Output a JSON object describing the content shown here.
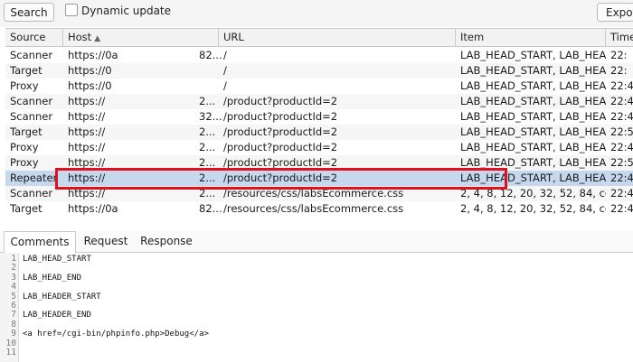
{
  "toolbar": {
    "search_label": "Search",
    "dynamic_update_label": "Dynamic update",
    "dynamic_update_checked": false,
    "export_label": "Expor"
  },
  "table": {
    "columns": [
      "Source",
      "Host",
      "URL",
      "Item",
      "Time"
    ],
    "sorted_column": "Host",
    "rows": [
      {
        "source": "Scanner",
        "host_a": "https://0a",
        "host_b": "82...",
        "url": "/",
        "item": "LAB_HEAD_START, LAB_HEA...",
        "time": "22:"
      },
      {
        "source": "Target",
        "host_a": "https://0",
        "host_b": "",
        "url": "/",
        "item": "LAB_HEAD_START, LAB_HEA...",
        "time": "22:"
      },
      {
        "source": "Proxy",
        "host_a": "https://0",
        "host_b": "",
        "url": "/",
        "item": "LAB_HEAD_START, LAB_HEA...",
        "time": "22:4"
      },
      {
        "source": "Scanner",
        "host_a": "https://",
        "host_b": "2...",
        "url": "/product?productId=2",
        "item": "LAB_HEAD_START, LAB_HEA...",
        "time": "22:4"
      },
      {
        "source": "Scanner",
        "host_a": "https://",
        "host_b": "32...",
        "url": "/product?productId=2",
        "item": "LAB_HEAD_START, LAB_HEA...",
        "time": "22:4"
      },
      {
        "source": "Target",
        "host_a": "https://",
        "host_b": "2...",
        "url": "/product?productId=2",
        "item": "LAB_HEAD_START, LAB_HEA...",
        "time": "22:5"
      },
      {
        "source": "Proxy",
        "host_a": "https://",
        "host_b": "2...",
        "url": "/product?productId=2",
        "item": "LAB_HEAD_START, LAB_HEA...",
        "time": "22:4"
      },
      {
        "source": "Proxy",
        "host_a": "https://",
        "host_b": "2...",
        "url": "/product?productId=2",
        "item": "LAB_HEAD_START, LAB_HEA...",
        "time": "22:5"
      },
      {
        "source": "Repeater",
        "host_a": "https://",
        "host_b": "2...",
        "url": "/product?productId=2",
        "item": "LAB_HEAD_START, LAB_HEA...",
        "time": "22:4"
      },
      {
        "source": "Scanner",
        "host_a": "https://",
        "host_b": "2...",
        "url": "/resources/css/labsEcommerce.css",
        "item": "2, 4, 8, 12, 20, 32, 52, 84, co...",
        "time": "22:4"
      },
      {
        "source": "Target",
        "host_a": "https://0a",
        "host_b": "82...",
        "url": "/resources/css/labsEcommerce.css",
        "item": "2, 4, 8, 12, 20, 32, 52, 84, co...",
        "time": "22:4"
      }
    ],
    "selected_row": 8
  },
  "tabs": [
    "Comments",
    "Request",
    "Response"
  ],
  "active_tab": "Comments",
  "editor": {
    "lines": [
      {
        "n": "1",
        "text": "LAB_HEAD_START"
      },
      {
        "n": "2",
        "text": ""
      },
      {
        "n": "3",
        "text": "LAB_HEAD_END"
      },
      {
        "n": "4",
        "text": ""
      },
      {
        "n": "5",
        "text": "LAB_HEADER_START"
      },
      {
        "n": "6",
        "text": ""
      },
      {
        "n": "7",
        "text": "LAB_HEADER_END"
      },
      {
        "n": "8",
        "text": ""
      },
      {
        "n": "9",
        "text": "<a href=/cgi-bin/phpinfo.php>Debug</a>"
      },
      {
        "n": "10",
        "text": ""
      },
      {
        "n": "11",
        "text": ""
      }
    ]
  }
}
